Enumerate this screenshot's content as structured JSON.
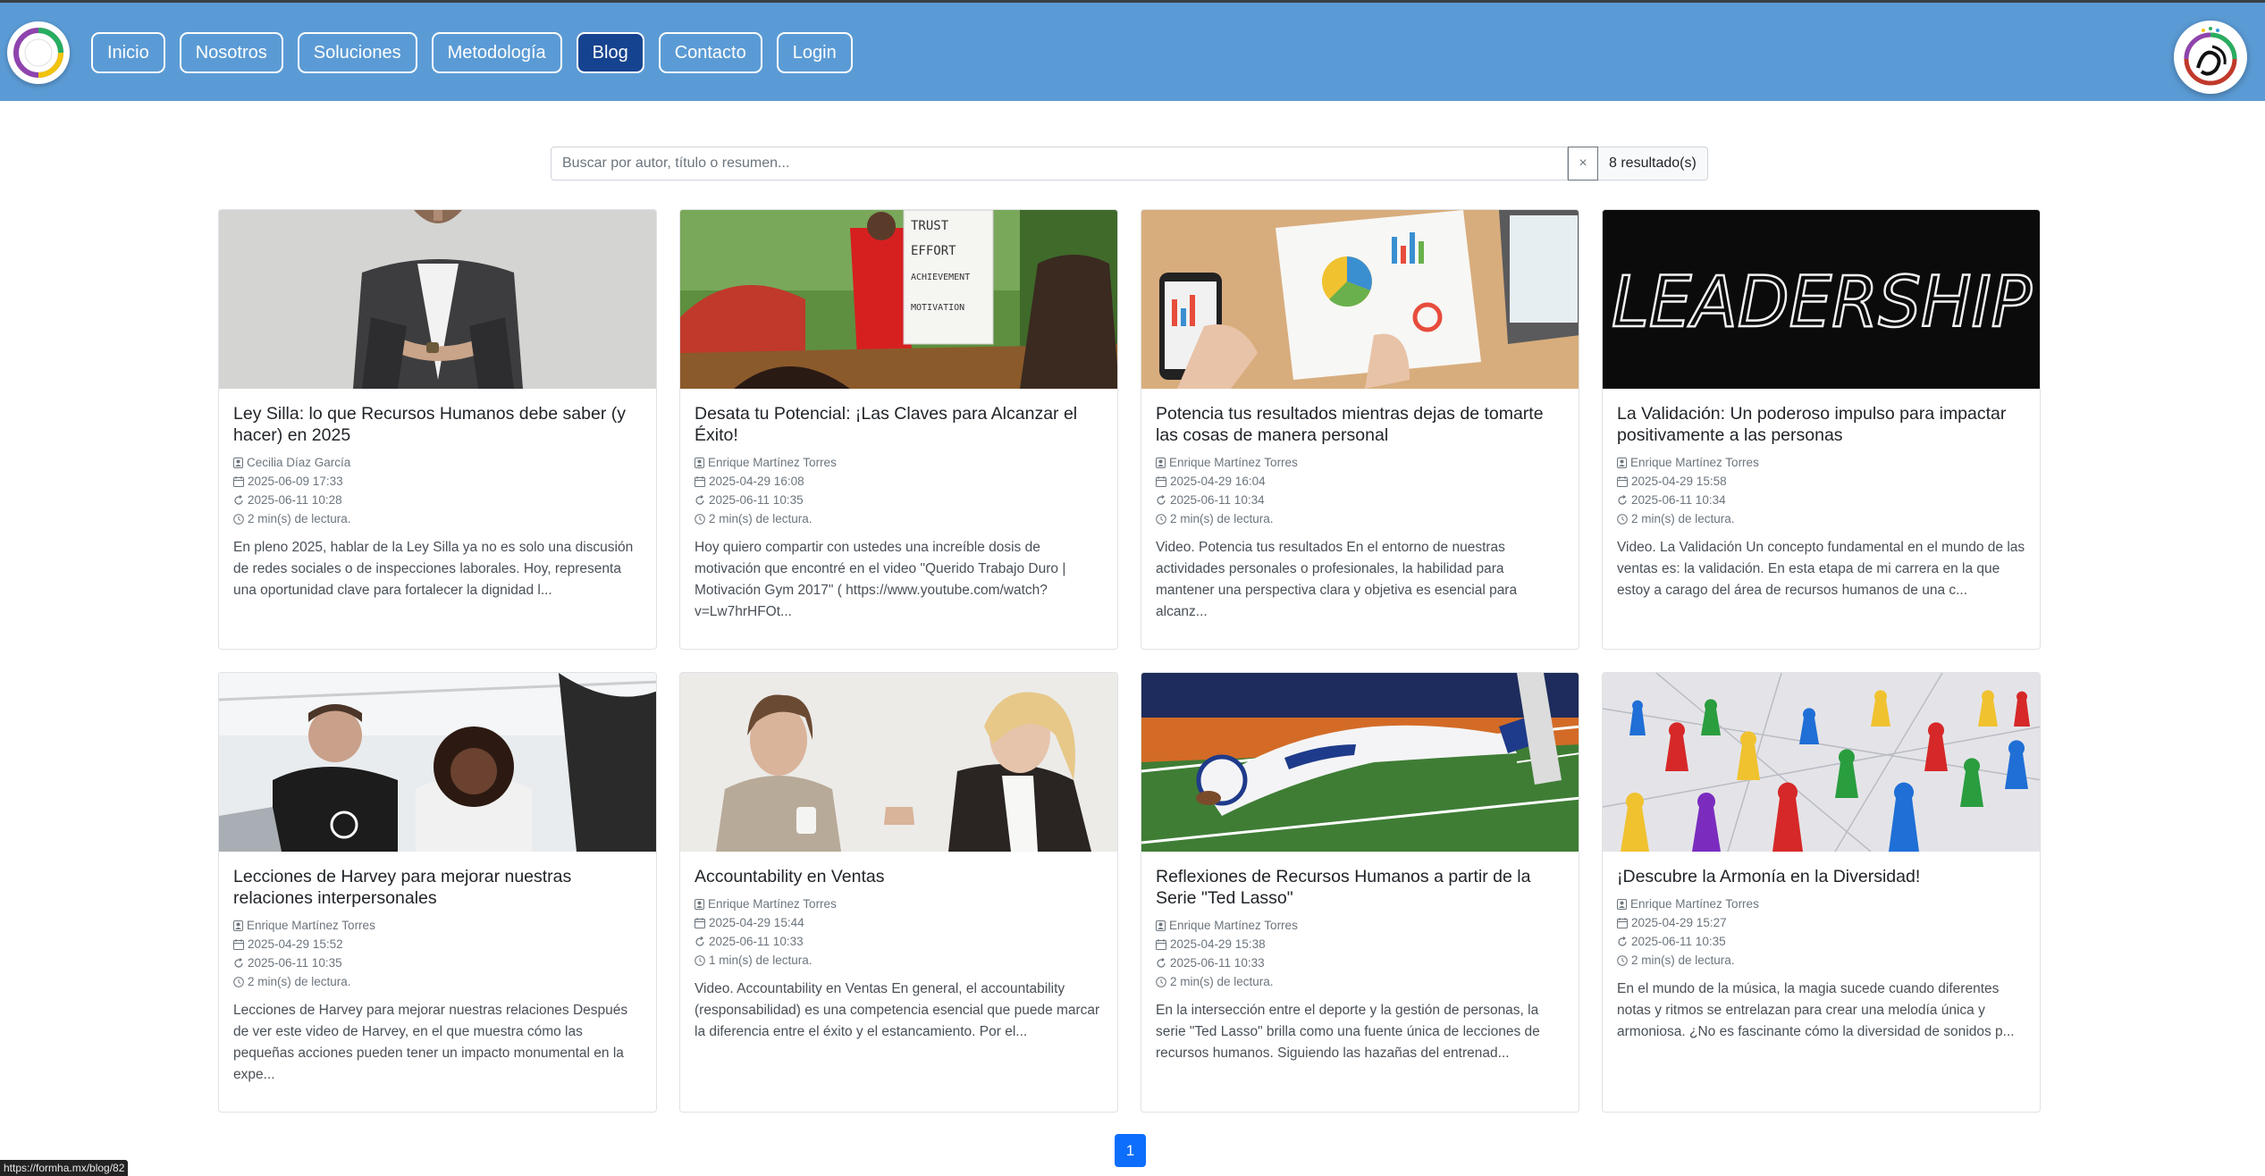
{
  "nav": {
    "items": [
      {
        "label": "Inicio",
        "active": false
      },
      {
        "label": "Nosotros",
        "active": false
      },
      {
        "label": "Soluciones",
        "active": false
      },
      {
        "label": "Metodología",
        "active": false
      },
      {
        "label": "Blog",
        "active": true
      },
      {
        "label": "Contacto",
        "active": false
      },
      {
        "label": "Login",
        "active": false
      }
    ]
  },
  "search": {
    "placeholder": "Buscar por autor, título o resumen...",
    "value": "",
    "clear_label": "×",
    "result_count": "8 resultado(s)"
  },
  "posts": [
    {
      "title": "Ley Silla: lo que Recursos Humanos debe saber (y hacer) en 2025",
      "author": "Cecilia Díaz García",
      "created": "2025-06-09 17:33",
      "updated": "2025-06-11 10:28",
      "reading": "2 min(s) de lectura.",
      "excerpt": "En pleno 2025, hablar de la Ley Silla ya no es solo una discusión de redes sociales o de inspecciones laborales. Hoy, representa una oportunidad clave para fortalecer la dignidad l...",
      "image": "man-in-suit-photo"
    },
    {
      "title": "Desata tu Potencial: ¡Las Claves para Alcanzar el Éxito!",
      "author": "Enrique Martínez Torres",
      "created": "2025-04-29 16:08",
      "updated": "2025-06-11 10:35",
      "reading": "2 min(s) de lectura.",
      "excerpt": "Hoy quiero compartir con ustedes una increíble dosis de motivación que encontré en el video \"Querido Trabajo Duro | Motivación Gym 2017\" ( https://www.youtube.com/watch?v=Lw7hrHFOt...",
      "image": "trust-board-photo",
      "board_text": [
        "TRUST",
        "EFFORT",
        "ACHIEVEMENT",
        "MOTIVATION"
      ]
    },
    {
      "title": "Potencia tus resultados mientras dejas de tomarte las cosas de manera personal",
      "author": "Enrique Martínez Torres",
      "created": "2025-04-29 16:04",
      "updated": "2025-06-11 10:34",
      "reading": "2 min(s) de lectura.",
      "excerpt": "Video. Potencia tus resultados En el entorno de nuestras actividades personales o profesionales, la habilidad para mantener una perspectiva clara y objetiva es esencial para alcanz...",
      "image": "charts-desk-photo"
    },
    {
      "title": "La Validación: Un poderoso impulso para impactar positivamente a las personas",
      "author": "Enrique Martínez Torres",
      "created": "2025-04-29 15:58",
      "updated": "2025-06-11 10:34",
      "reading": "2 min(s) de lectura.",
      "excerpt": "Video. La Validación Un concepto fundamental en el mundo de las ventas es: la validación. En esta etapa de mi carrera en la que estoy a carago del área de recursos humanos de una c...",
      "image": "leadership-chalk-photo",
      "board_text": [
        "LEADERSHIP"
      ]
    },
    {
      "title": "Lecciones de Harvey para mejorar nuestras relaciones interpersonales",
      "author": "Enrique Martínez Torres",
      "created": "2025-04-29 15:52",
      "updated": "2025-06-11 10:35",
      "reading": "2 min(s) de lectura.",
      "excerpt": "Lecciones de Harvey para mejorar nuestras relaciones Después de ver este video de Harvey, en el que muestra cómo las pequeñas acciones pueden tener un impacto monumental en la expe...",
      "image": "team-laptop-photo"
    },
    {
      "title": "Accountability en Ventas",
      "author": "Enrique Martínez Torres",
      "created": "2025-04-29 15:44",
      "updated": "2025-06-11 10:33",
      "reading": "1 min(s) de lectura.",
      "excerpt": "Video. Accountability en Ventas En general, el accountability (responsabilidad) es una competencia esencial que puede marcar la diferencia entre el éxito y el estancamiento. Por el...",
      "image": "two-women-photo"
    },
    {
      "title": "Reflexiones de Recursos Humanos a partir de la Serie \"Ted Lasso\"",
      "author": "Enrique Martínez Torres",
      "created": "2025-04-29 15:38",
      "updated": "2025-06-11 10:33",
      "reading": "2 min(s) de lectura.",
      "excerpt": "En la intersección entre el deporte y la gestión de personas, la serie \"Ted Lasso\" brilla como una fuente única de lecciones de recursos humanos. Siguiendo las hazañas del entrenad...",
      "image": "football-dive-photo"
    },
    {
      "title": "¡Descubre la Armonía en la Diversidad!",
      "author": "Enrique Martínez Torres",
      "created": "2025-04-29 15:27",
      "updated": "2025-06-11 10:35",
      "reading": "2 min(s) de lectura.",
      "excerpt": "En el mundo de la música, la magia sucede cuando diferentes notas y ritmos se entrelazan para crear una melodía única y armoniosa. ¿No es fascinante cómo la diversidad de sonidos p...",
      "image": "colored-pawns-photo"
    }
  ],
  "pagination": {
    "current": "1"
  },
  "status_url": "https://formha.mx/blog/82",
  "colors": {
    "navbar": "#5b9bd5",
    "nav_active": "#16438f",
    "page_active": "#0d6efd"
  }
}
